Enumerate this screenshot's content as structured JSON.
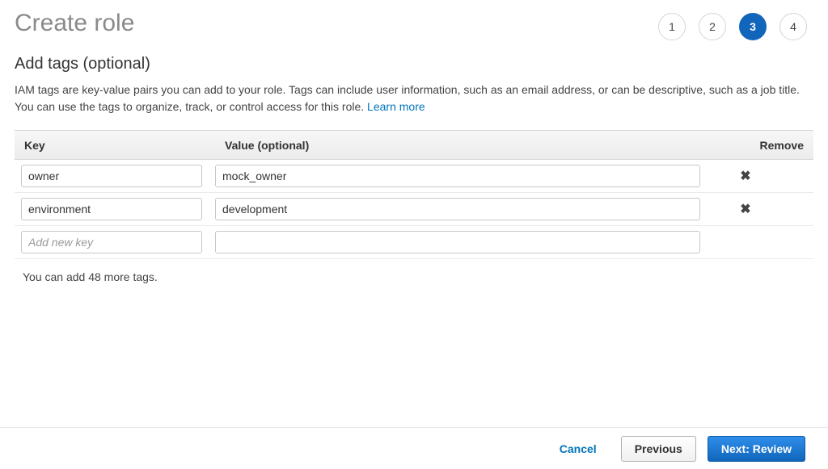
{
  "header": {
    "title": "Create role",
    "steps": [
      "1",
      "2",
      "3",
      "4"
    ],
    "active_step_index": 2
  },
  "content": {
    "subheading": "Add tags (optional)",
    "description_prefix": "IAM tags are key-value pairs you can add to your role. Tags can include user information, such as an email address, or can be descriptive, such as a job title. You can use the tags to organize, track, or control access for this role. ",
    "learn_more": "Learn more",
    "columns": {
      "key": "Key",
      "value": "Value (optional)",
      "remove": "Remove"
    },
    "tags": [
      {
        "key": "owner",
        "value": "mock_owner"
      },
      {
        "key": "environment",
        "value": "development"
      }
    ],
    "new_row_placeholder": "Add new key",
    "remaining_text": "You can add 48 more tags."
  },
  "footer": {
    "cancel": "Cancel",
    "previous": "Previous",
    "next": "Next: Review"
  }
}
